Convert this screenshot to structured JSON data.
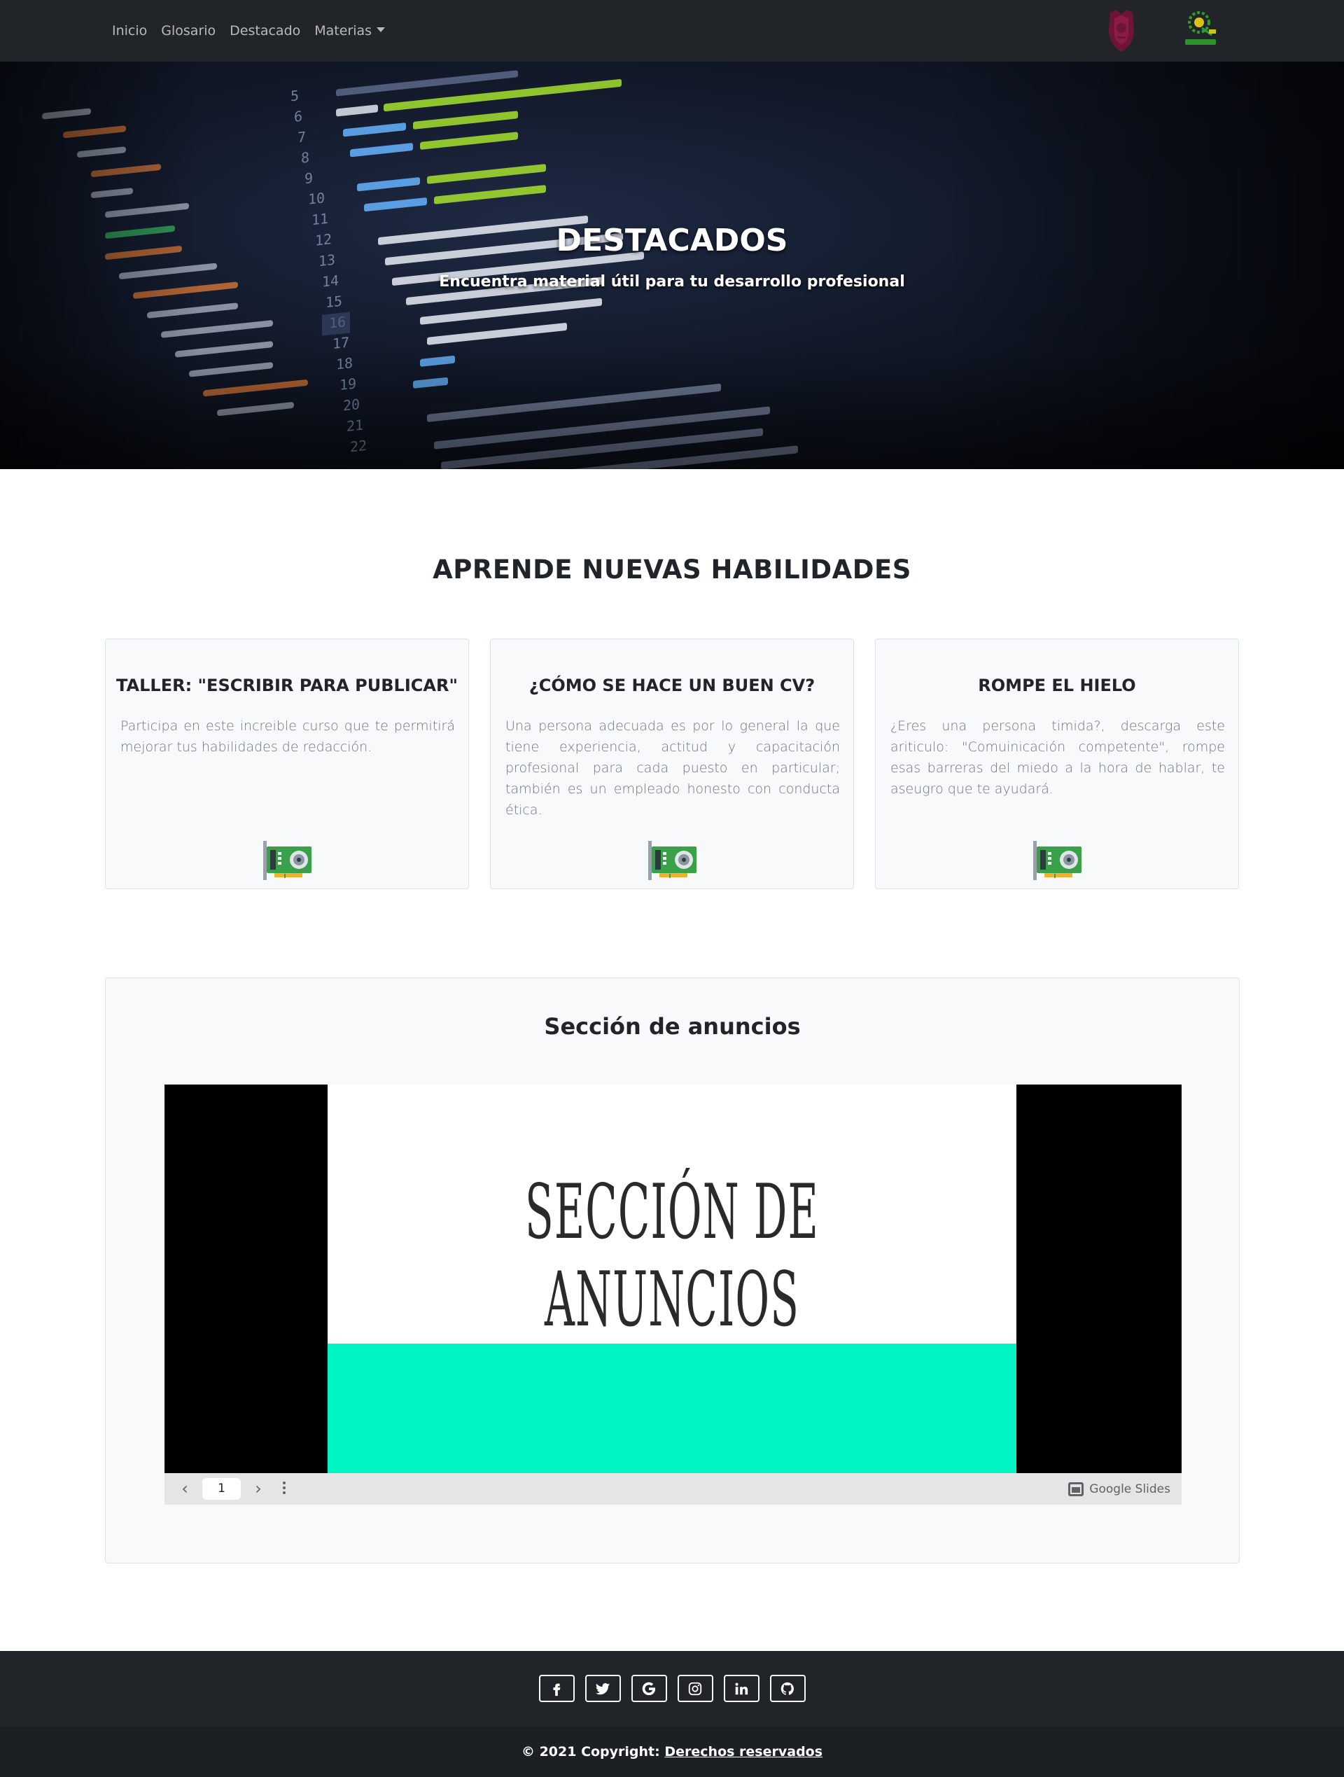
{
  "navbar": {
    "links": [
      "Inicio",
      "Glosario",
      "Destacado",
      "Materias"
    ],
    "logo_left_icon": "university-crest-icon",
    "logo_right_icon": "upiicsa-logo-icon"
  },
  "hero": {
    "title": "DESTACADOS",
    "subtitle": "Encuentra material útil para tu desarrollo profesional",
    "background": "code-editor-photo"
  },
  "skills": {
    "title": "APRENDE NUEVAS HABILIDADES",
    "cards": [
      {
        "title": "TALLER: \"ESCRIBIR PARA PUBLICAR\"",
        "text": "Participa en este increible curso que te permitirá mejorar tus habilidades de redacción.",
        "icon": "graphics-card-icon"
      },
      {
        "title": "¿CÓMO SE HACE UN BUEN CV?",
        "text": "Una persona adecuada es por lo general la que tiene experiencia, actitud y capacitación profesional para cada puesto en particular; también es un empleado honesto con conducta ética.",
        "icon": "graphics-card-icon"
      },
      {
        "title": "ROMPE EL HIELO",
        "text": "¿Eres una persona timida?, descarga este ariticulo: \"Comuinicación competente\", rompe esas barreras del miedo a la hora de hablar, te aseugro que te ayudará.",
        "icon": "graphics-card-icon"
      }
    ]
  },
  "announcements": {
    "title": "Sección de anuncios",
    "slide_heading": "SECCIÓN DE ANUNCIOS",
    "slide_page": "1",
    "brand": "Google Slides",
    "accent_color": "#00f5c4"
  },
  "footer": {
    "social_icons": [
      "facebook-icon",
      "twitter-icon",
      "google-icon",
      "instagram-icon",
      "linkedin-icon",
      "github-icon"
    ],
    "copyright_prefix": "© 2021 Copyright: ",
    "copyright_link": "Derechos reservados"
  },
  "colors": {
    "navbar_bg": "#212529",
    "footer_bg": "#212529",
    "card_bg": "#f8f9fa"
  }
}
